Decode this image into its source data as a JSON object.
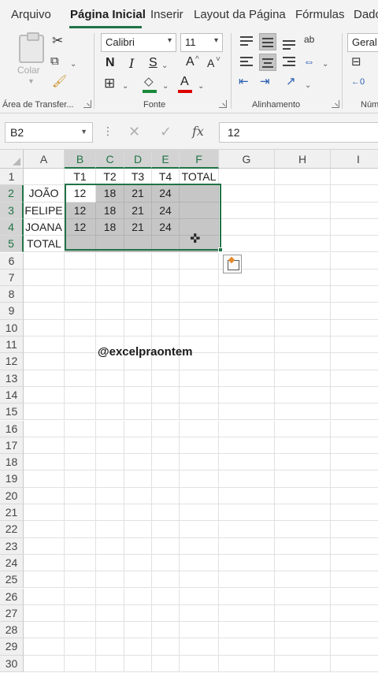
{
  "menu": {
    "tabs": [
      "Arquivo",
      "Página Inicial",
      "Inserir",
      "Layout da Página",
      "Fórmulas",
      "Dado"
    ],
    "active_tab": "Página Inicial"
  },
  "ribbon": {
    "clipboard": {
      "paste_label": "Colar",
      "group_label": "Área de Transfer..."
    },
    "font": {
      "font_name": "Calibri",
      "font_size": "11",
      "bold": "N",
      "italic": "I",
      "underline": "S",
      "grow": "A",
      "shrink": "A",
      "font_color_letter": "A",
      "group_label": "Fonte",
      "fill_color": "#1a8a3b",
      "font_color": "#d00000"
    },
    "alignment": {
      "group_label": "Alinhamento",
      "wrap_icon": "ab"
    },
    "number": {
      "format": "Geral",
      "group_label": "Núm"
    }
  },
  "formula_bar": {
    "name_box": "B2",
    "fx": "fx",
    "value": "12"
  },
  "grid": {
    "columns": [
      "A",
      "B",
      "C",
      "D",
      "E",
      "F",
      "G",
      "H",
      "I"
    ],
    "selected_columns": [
      "B",
      "C",
      "D",
      "E",
      "F"
    ],
    "rows": [
      "1",
      "2",
      "3",
      "4",
      "5",
      "6",
      "7",
      "8",
      "9",
      "10",
      "11",
      "12",
      "13",
      "14",
      "15",
      "16",
      "17",
      "18",
      "19",
      "20",
      "21",
      "22",
      "23",
      "24",
      "25",
      "26",
      "27",
      "28",
      "29",
      "30"
    ],
    "selected_rows": [
      "2",
      "3",
      "4",
      "5"
    ],
    "header_row": [
      "",
      "T1",
      "T2",
      "T3",
      "T4",
      "TOTAL"
    ],
    "data_rows": [
      {
        "name": "JOÃO",
        "values": [
          "12",
          "18",
          "21",
          "24",
          ""
        ]
      },
      {
        "name": "FELIPE",
        "values": [
          "12",
          "18",
          "21",
          "24",
          ""
        ]
      },
      {
        "name": "JOANA",
        "values": [
          "12",
          "18",
          "21",
          "24",
          ""
        ]
      },
      {
        "name": "TOTAL",
        "values": [
          "",
          "",
          "",
          "",
          ""
        ]
      }
    ],
    "active_cell": "B2",
    "selection": "B2:F5",
    "accent": "#217346"
  },
  "watermark": "@excelpraontem"
}
